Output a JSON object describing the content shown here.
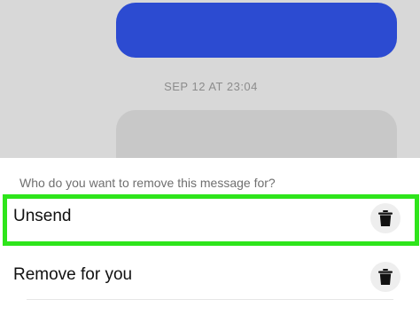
{
  "chat": {
    "timestamp": "SEP 12 AT 23:04"
  },
  "sheet": {
    "question": "Who do you want to remove this message for?",
    "options": [
      {
        "label": "Unsend",
        "icon": "trash-icon",
        "highlighted": true
      },
      {
        "label": "Remove for you",
        "icon": "trash-icon",
        "highlighted": false
      }
    ]
  },
  "colors": {
    "sent_bubble": "#2c4bd1",
    "highlight": "#2ee51b",
    "chat_background": "#d8d8d8"
  }
}
